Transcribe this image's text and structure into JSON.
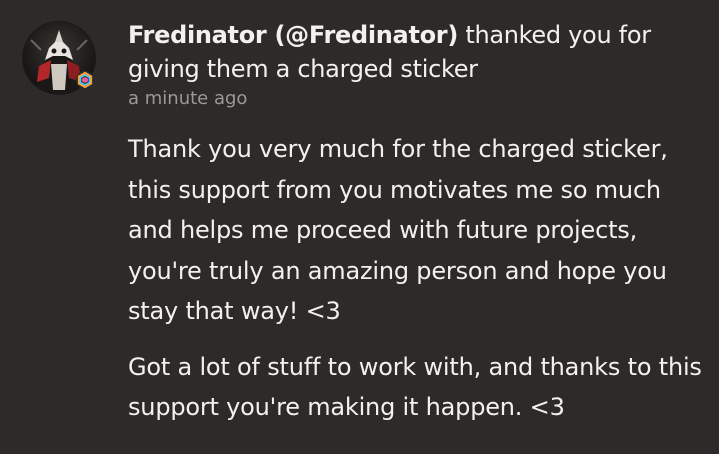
{
  "notification": {
    "avatar_icon": "user-avatar-with-badge",
    "username": "Fredinator (@Fredinator)",
    "action_text": " thanked you for giving them a charged sticker",
    "timestamp": "a minute ago",
    "message": {
      "paragraph_1": "Thank you very much for the charged sticker, this support from you motivates me so much and helps me proceed with future projects, you're truly an amazing person and hope you stay that way! <3",
      "paragraph_2": "Got a lot of stuff to work with, and thanks to this support you're making it happen. <3"
    }
  },
  "colors": {
    "background": "#2d2b29",
    "text": "#f3f1ee",
    "muted": "#9d9894"
  }
}
